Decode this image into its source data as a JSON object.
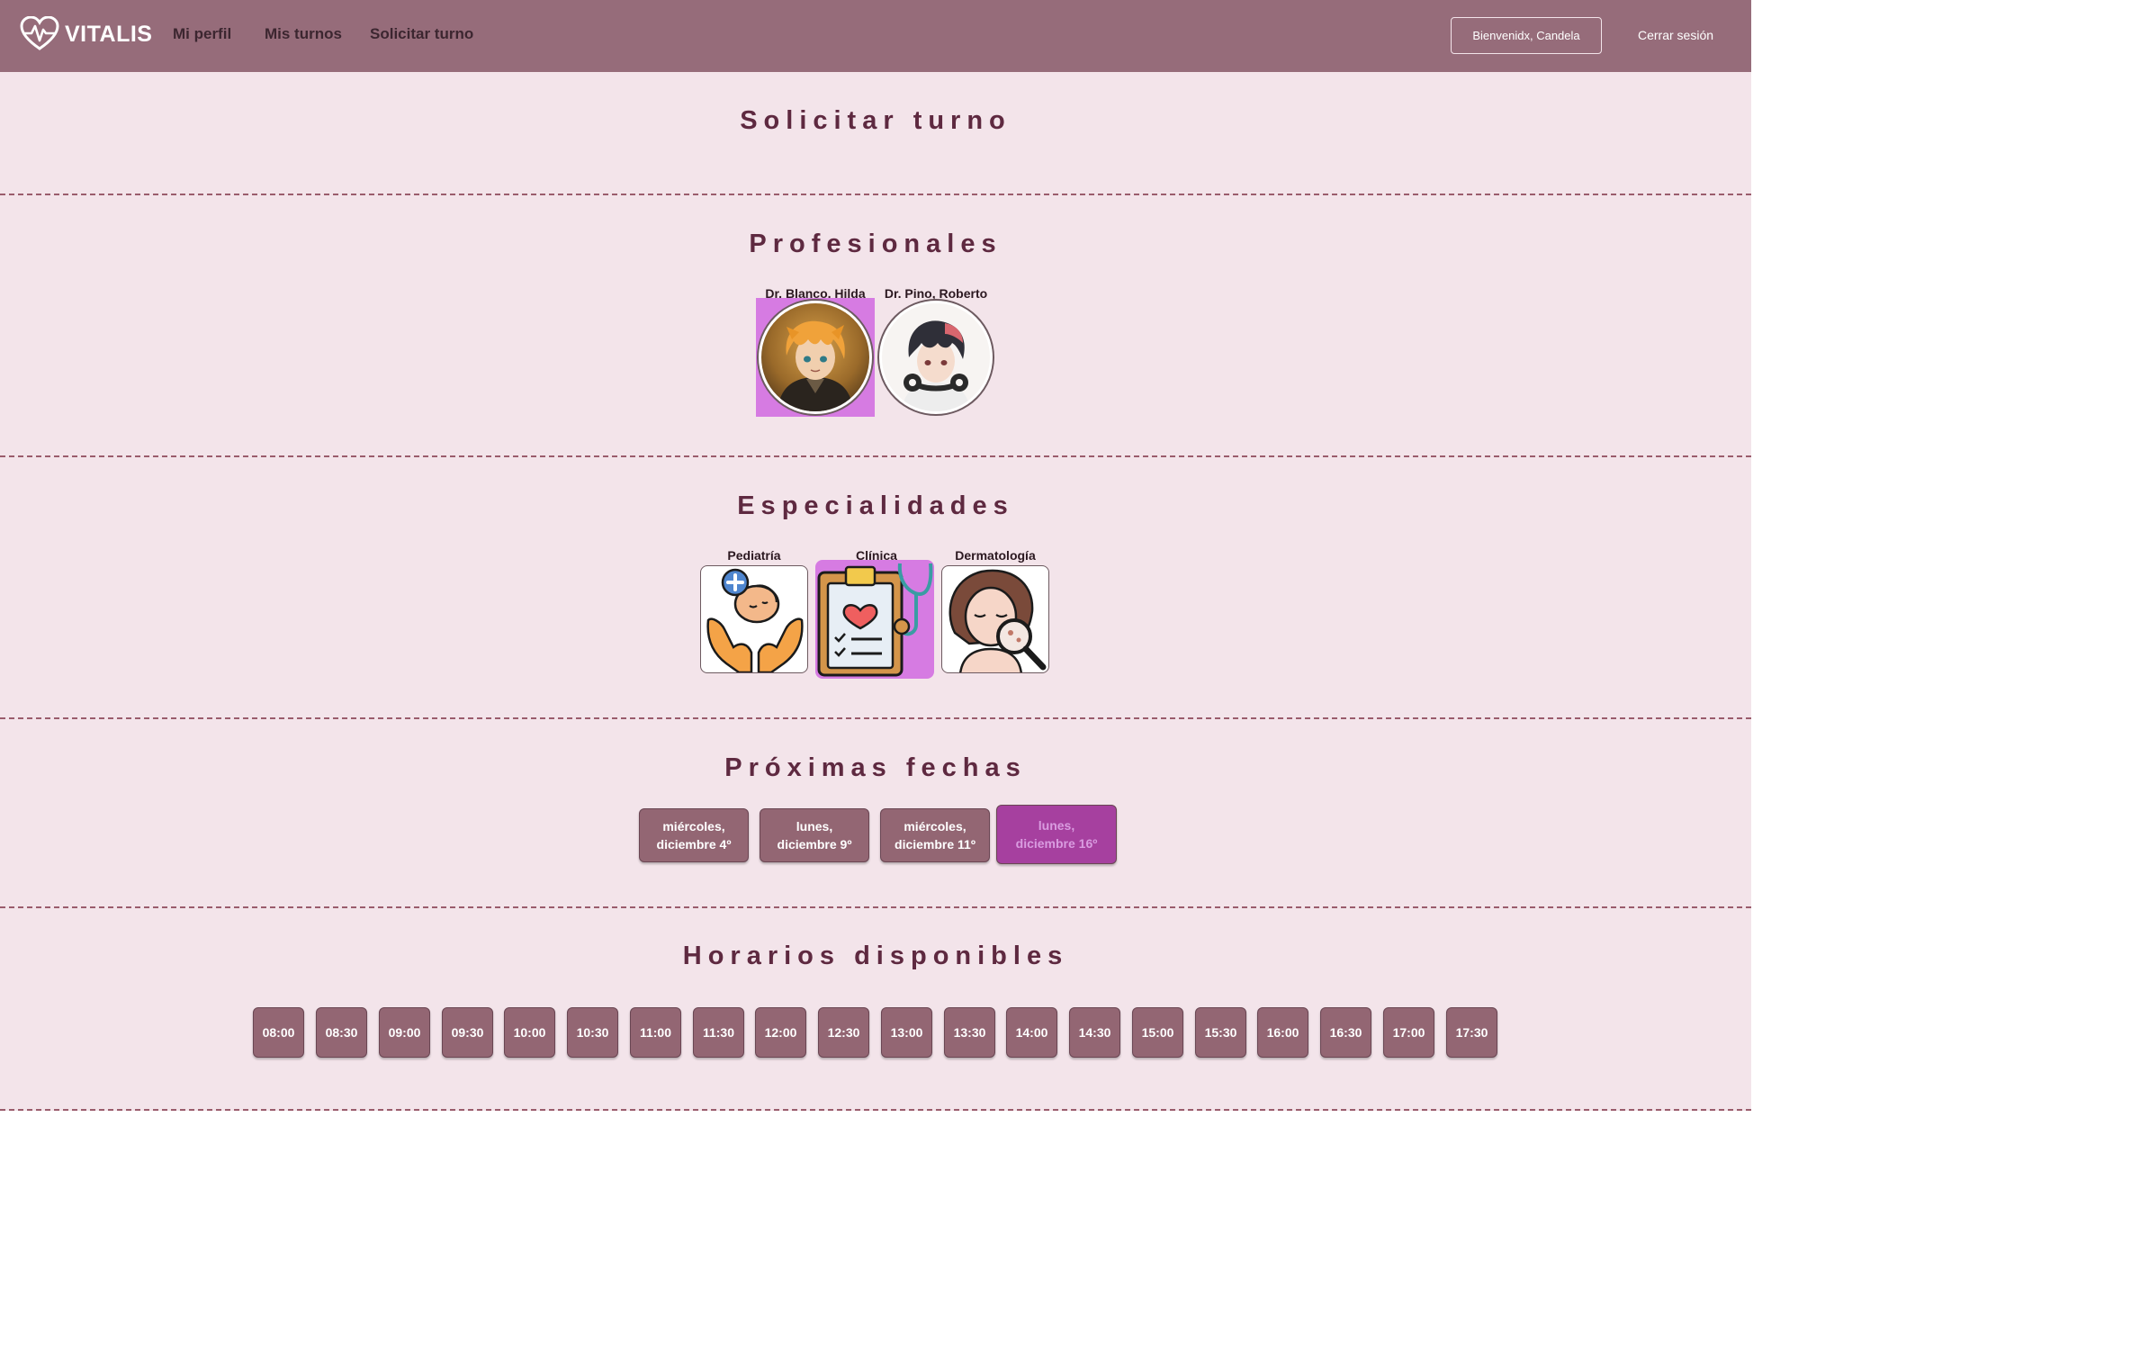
{
  "navbar": {
    "brand": "VITALIS",
    "links": [
      "Mi perfil",
      "Mis turnos",
      "Solicitar turno"
    ],
    "welcome": "Bienvenidx, Candela",
    "logout": "Cerrar sesión"
  },
  "page_title": "Solicitar turno",
  "professionals": {
    "heading": "Profesionales",
    "items": [
      {
        "name": "Dr. Blanco, Hilda",
        "selected": true,
        "avatar": "orange-haired-avatar"
      },
      {
        "name": "Dr. Pino, Roberto",
        "selected": false,
        "avatar": "headphones-avatar"
      }
    ]
  },
  "specialties": {
    "heading": "Especialidades",
    "items": [
      {
        "name": "Pediatría",
        "selected": false,
        "icon": "baby-in-hands-icon"
      },
      {
        "name": "Clínica",
        "selected": true,
        "icon": "clipboard-stethoscope-icon"
      },
      {
        "name": "Dermatología",
        "selected": false,
        "icon": "face-magnifier-icon"
      }
    ]
  },
  "dates": {
    "heading": "Próximas fechas",
    "items": [
      {
        "line1": "miércoles,",
        "line2": "diciembre 4º",
        "selected": false
      },
      {
        "line1": "lunes,",
        "line2": "diciembre 9º",
        "selected": false
      },
      {
        "line1": "miércoles,",
        "line2": "diciembre 11º",
        "selected": false
      },
      {
        "line1": "lunes,",
        "line2": "diciembre 16º",
        "selected": true
      }
    ]
  },
  "times": {
    "heading": "Horarios disponibles",
    "items": [
      "08:00",
      "08:30",
      "09:00",
      "09:30",
      "10:00",
      "10:30",
      "11:00",
      "11:30",
      "12:00",
      "12:30",
      "13:00",
      "13:30",
      "14:00",
      "14:30",
      "15:00",
      "15:30",
      "16:00",
      "16:30",
      "17:00",
      "17:30"
    ]
  },
  "colors": {
    "navbar": "#966c7a",
    "background": "#f3e4ea",
    "heading": "#5e2940",
    "button": "#936673",
    "selected": "#d67be2",
    "selected_date": "#a6409f"
  }
}
